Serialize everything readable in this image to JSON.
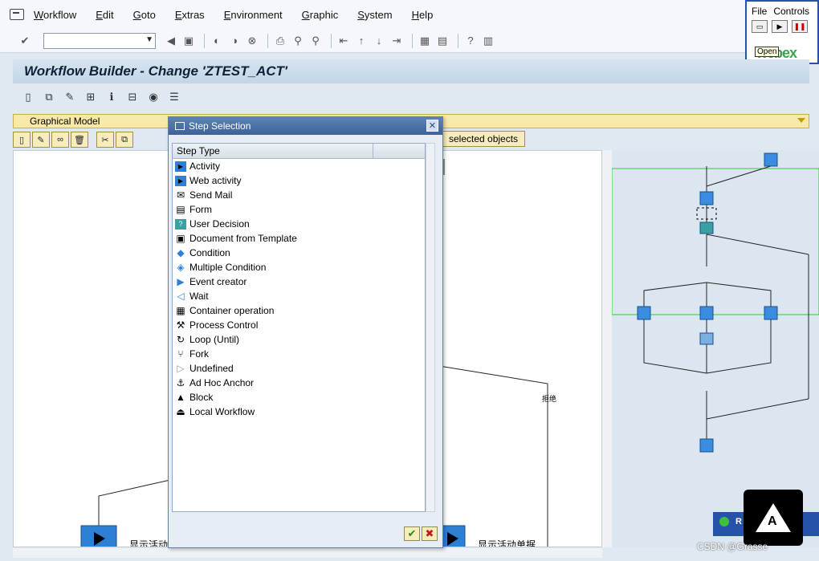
{
  "menu": [
    "Workflow",
    "Edit",
    "Goto",
    "Extras",
    "Environment",
    "Graphic",
    "System",
    "Help"
  ],
  "command_field": {
    "value": ""
  },
  "title": "Workflow Builder - Change 'ZTEST_ACT'",
  "graphical_model_tab": "Graphical Model",
  "selected_objects_label": "selected objects",
  "dialog": {
    "title": "Step Selection",
    "column_header": "Step Type",
    "items": [
      "Activity",
      "Web activity",
      "Send Mail",
      "Form",
      "User Decision",
      "Document from Template",
      "Condition",
      "Multiple Condition",
      "Event creator",
      "Wait",
      "Container operation",
      "Process Control",
      "Loop (Until)",
      "Fork",
      "Undefined",
      "Ad Hoc Anchor",
      "Block",
      "Local Workflow"
    ]
  },
  "canvas": {
    "label1": "显示活动",
    "label2": "显示活动单据",
    "branch_label": "拒绝"
  },
  "webex": {
    "menu_file": "File",
    "menu_controls": "Controls",
    "tooltip": "Open",
    "brand": "webex"
  },
  "watermark": "CSDN @Grasse",
  "mini_panel": "R",
  "colors": {
    "accent": "#3c6298",
    "node_blue": "#2e7fd6",
    "selection": "#33cc33"
  }
}
